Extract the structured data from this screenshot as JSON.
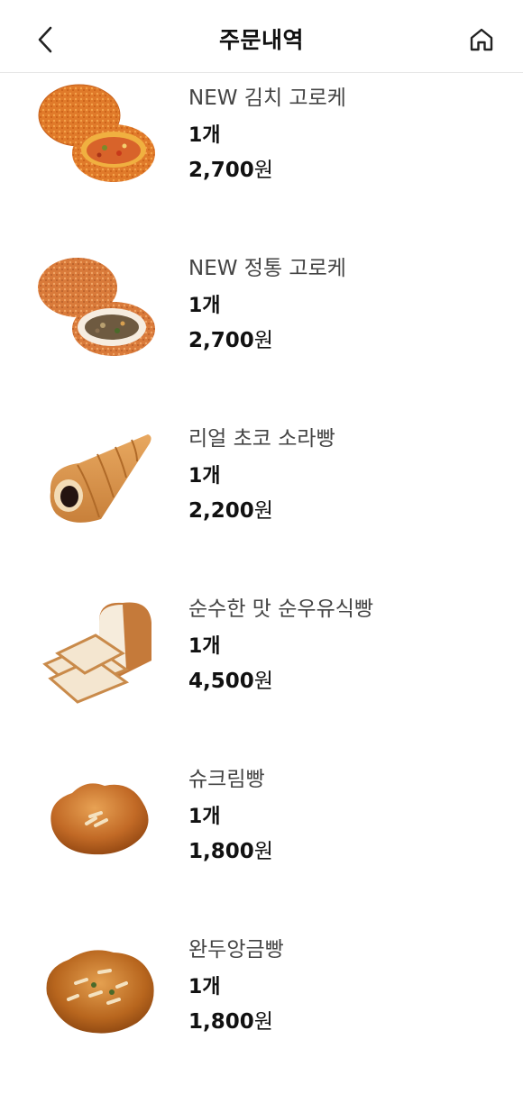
{
  "header": {
    "title": "주문내역",
    "back_icon": "chevron-left-icon",
    "home_icon": "home-icon"
  },
  "items": [
    {
      "name": "NEW 김치 고로케",
      "qty": "1개",
      "price": "2,700",
      "unit": "원",
      "image": "kimchi-croquette"
    },
    {
      "name": "NEW 정통 고로케",
      "qty": "1개",
      "price": "2,700",
      "unit": "원",
      "image": "classic-croquette"
    },
    {
      "name": "리얼 초코 소라빵",
      "qty": "1개",
      "price": "2,200",
      "unit": "원",
      "image": "chocolate-cornet"
    },
    {
      "name": "순수한 맛 순우유식빵",
      "qty": "1개",
      "price": "4,500",
      "unit": "원",
      "image": "milk-bread-loaf"
    },
    {
      "name": "슈크림빵",
      "qty": "1개",
      "price": "1,800",
      "unit": "원",
      "image": "cream-bun"
    },
    {
      "name": "완두앙금빵",
      "qty": "1개",
      "price": "1,800",
      "unit": "원",
      "image": "pea-paste-bun"
    }
  ]
}
